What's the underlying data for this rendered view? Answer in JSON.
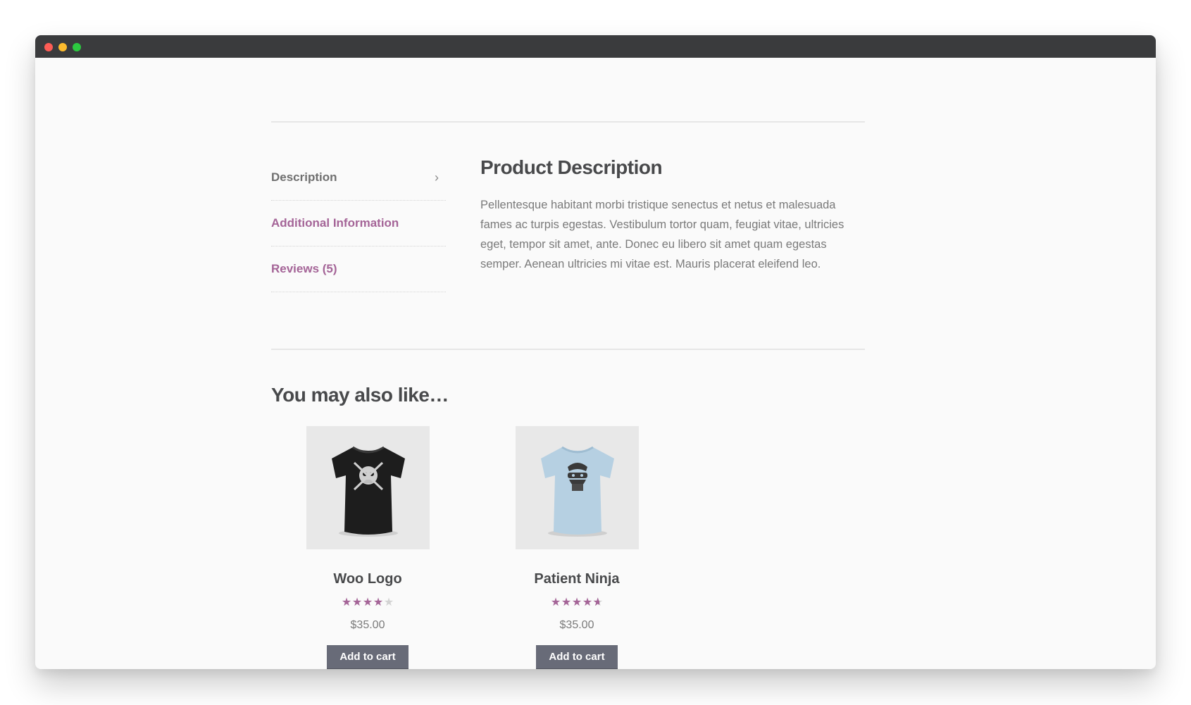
{
  "window": {
    "traffic_lights": [
      "close",
      "minimize",
      "zoom"
    ]
  },
  "tabs": [
    {
      "label": "Description",
      "state": "active",
      "icon": "chevron-right-icon"
    },
    {
      "label": "Additional Information",
      "state": "link"
    },
    {
      "label": "Reviews (5)",
      "state": "link"
    }
  ],
  "description": {
    "title": "Product Description",
    "body": "Pellentesque habitant morbi tristique senectus et netus et malesuada fames ac turpis egestas. Vestibulum tortor quam, feugiat vitae, ultricies eget, tempor sit amet, ante. Donec eu libero sit amet quam egestas semper. Aenean ultricies mi vitae est. Mauris placerat eleifend leo."
  },
  "related": {
    "title": "You may also like…",
    "products": [
      {
        "name": "Woo Logo",
        "rating": 4,
        "rating_max": 5,
        "price": "$35.00",
        "button": "Add to cart",
        "image": "black-tshirt-skull"
      },
      {
        "name": "Patient Ninja",
        "rating": 4.6,
        "rating_max": 5,
        "price": "$35.00",
        "button": "Add to cart",
        "image": "light-blue-tshirt-ninja"
      }
    ]
  },
  "colors": {
    "accent": "#a46497",
    "button": "#686b78",
    "heading": "#48494b",
    "text": "#7a7a7a",
    "titlebar": "#3a3b3d"
  }
}
